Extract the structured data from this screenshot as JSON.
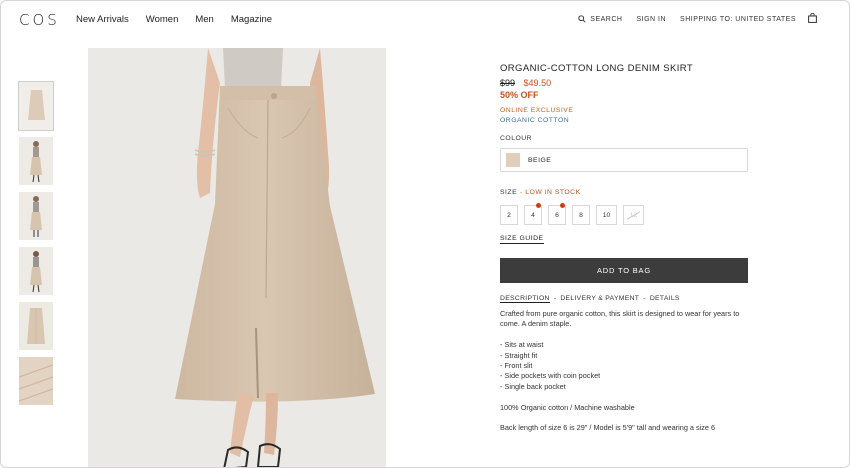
{
  "header": {
    "logo": "COS",
    "nav": [
      "New Arrivals",
      "Women",
      "Men",
      "Magazine"
    ],
    "search": "SEARCH",
    "sign_in": "SIGN IN",
    "shipping": "SHIPPING TO: UNITED STATES"
  },
  "product": {
    "title": "ORGANIC-COTTON LONG DENIM SKIRT",
    "old_price": "$99",
    "new_price": "$49.50",
    "discount": "50% OFF",
    "badge_exclusive": "ONLINE EXCLUSIVE",
    "badge_material": "ORGANIC COTTON",
    "colour_label": "COLOUR",
    "colour_value": "BEIGE",
    "size_label": "SIZE",
    "stock_note": "- LOW IN STOCK",
    "sizes": [
      "2",
      "4",
      "6",
      "8",
      "10",
      "12"
    ],
    "size_guide": "SIZE GUIDE",
    "add_to_bag": "ADD TO BAG",
    "tabs": [
      "DESCRIPTION",
      "-",
      "DELIVERY & PAYMENT",
      "-",
      "DETAILS"
    ],
    "description": "Crafted from pure organic cotton, this skirt is designed to wear for years to come. A denim staple.",
    "bullets": [
      "- Sits at waist",
      "- Straight fit",
      "- Front slit",
      "- Side pockets with coin pocket",
      "- Single back pocket"
    ],
    "composition": "100% Organic cotton / Machine washable",
    "fit_note": "Back length of size 6 is 29\" / Model is 5'9\" tall and wearing a size 6"
  },
  "colors": {
    "sale": "#c4511c",
    "exclusive": "#c4621c",
    "organic": "#3f6f9a",
    "button": "#3c3c3c",
    "swatch": "#e2cfbb"
  }
}
